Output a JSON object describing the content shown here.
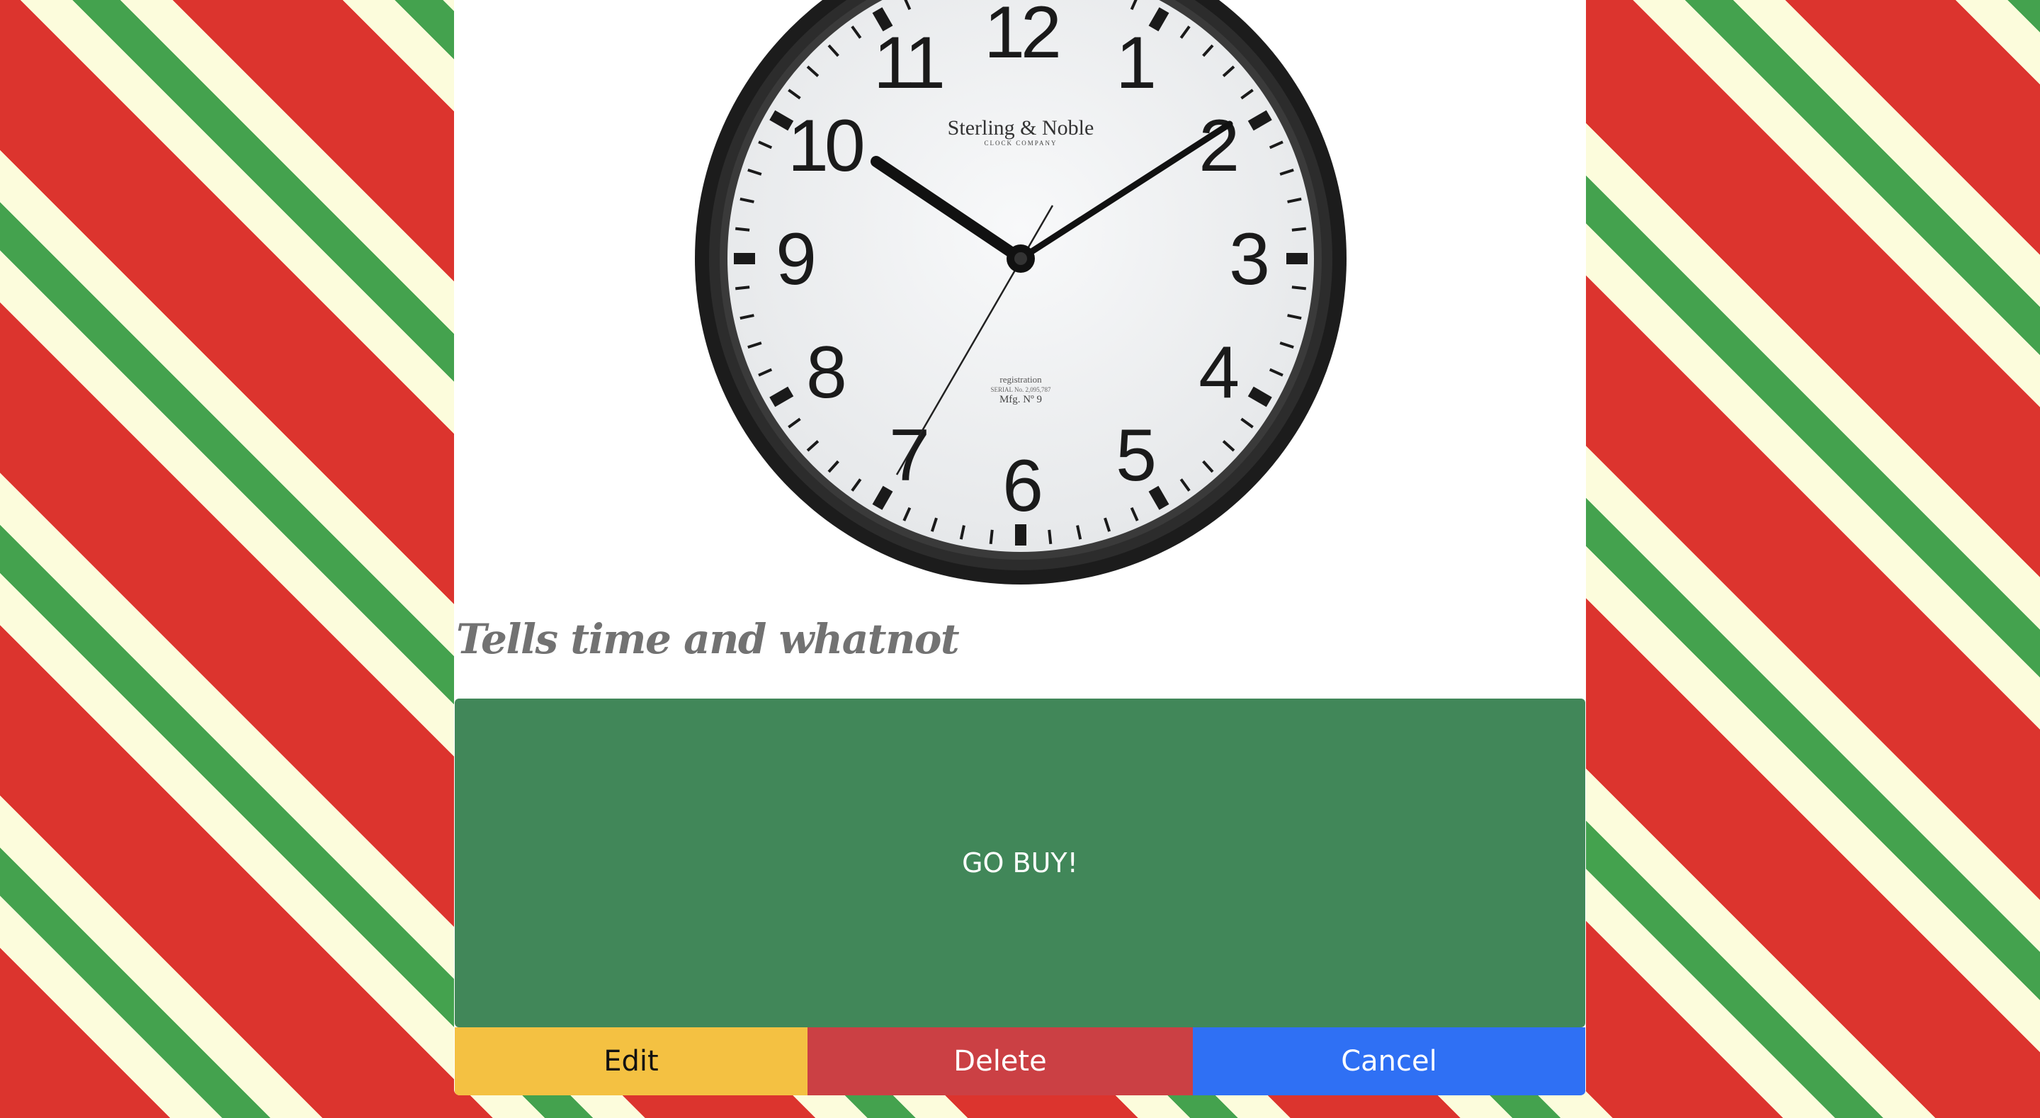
{
  "product": {
    "image_alt": "Wall clock",
    "clock_brand": "Sterling & Noble",
    "clock_brand_sub": "CLOCK COMPANY",
    "clock_registration": "registration",
    "clock_serial": "SERIAL No. 2,095,787",
    "clock_model": "Mfg. Nº 9",
    "description": "Tells time and whatnot"
  },
  "actions": {
    "buy_label": "GO BUY!",
    "edit_label": "Edit",
    "delete_label": "Delete",
    "cancel_label": "Cancel"
  },
  "colors": {
    "stripe_red": "#dc342e",
    "stripe_green": "#44a24e",
    "stripe_cream": "#fcfcdc",
    "buy_green": "#418759",
    "edit_yellow": "#f4c142",
    "delete_red": "#cb4044",
    "cancel_blue": "#2f70f4"
  }
}
